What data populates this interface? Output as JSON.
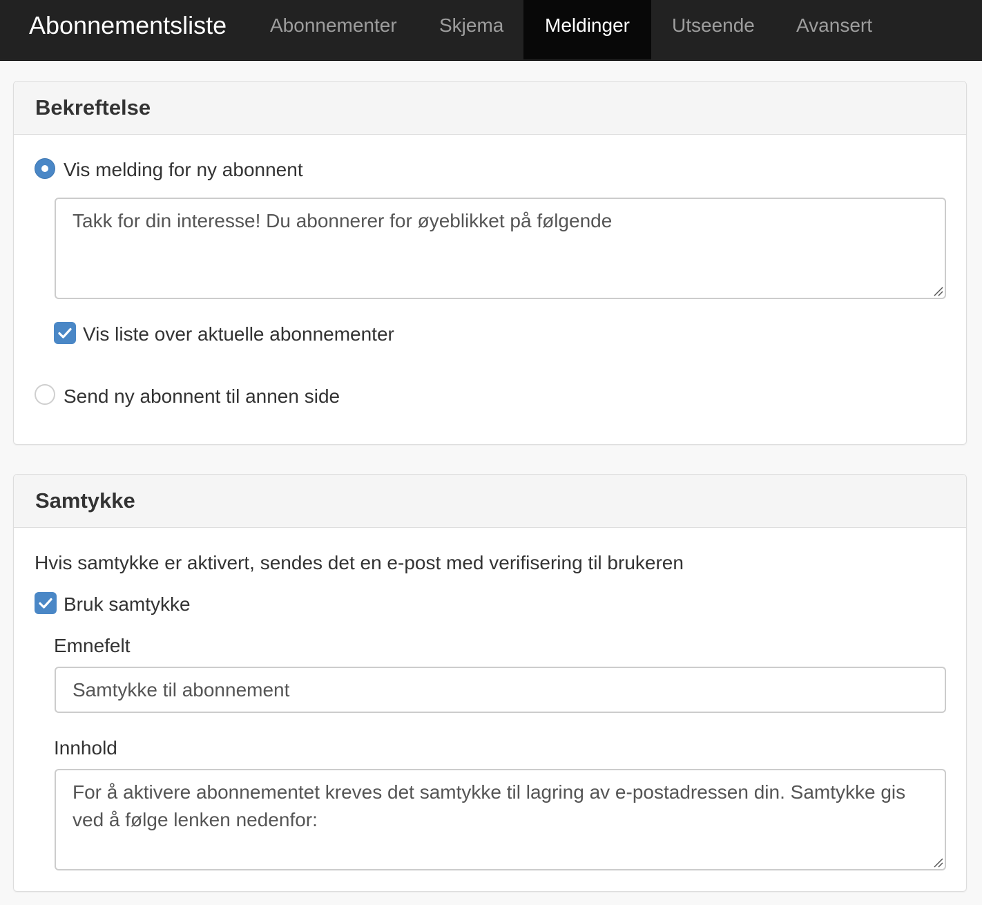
{
  "navbar": {
    "brand": "Abonnementsliste",
    "tabs": [
      {
        "label": "Abonnementer",
        "active": false
      },
      {
        "label": "Skjema",
        "active": false
      },
      {
        "label": "Meldinger",
        "active": true
      },
      {
        "label": "Utseende",
        "active": false
      },
      {
        "label": "Avansert",
        "active": false
      }
    ]
  },
  "confirmation": {
    "title": "Bekreftelse",
    "show_message_option": {
      "label": "Vis melding for ny abonnent",
      "selected": true
    },
    "message_text": "Takk for din interesse! Du abonnerer for øyeblikket på følgende",
    "show_list_option": {
      "label": "Vis liste over aktuelle abonnementer",
      "checked": true
    },
    "redirect_option": {
      "label": "Send ny abonnent til annen side",
      "selected": false
    }
  },
  "consent": {
    "title": "Samtykke",
    "description": "Hvis samtykke er aktivert, sendes det en e-post med verifisering til brukeren",
    "use_consent": {
      "label": "Bruk samtykke",
      "checked": true
    },
    "subject_label": "Emnefelt",
    "subject_value": "Samtykke til abonnement",
    "content_label": "Innhold",
    "content_value": "For å aktivere abonnementet kreves det samtykke til lagring av e-postadressen din. Samtykke gis ved å følge lenken nedenfor:"
  },
  "colors": {
    "navbar_bg": "#222222",
    "active_tab_bg": "#080808",
    "accent": "#4a87c6"
  }
}
